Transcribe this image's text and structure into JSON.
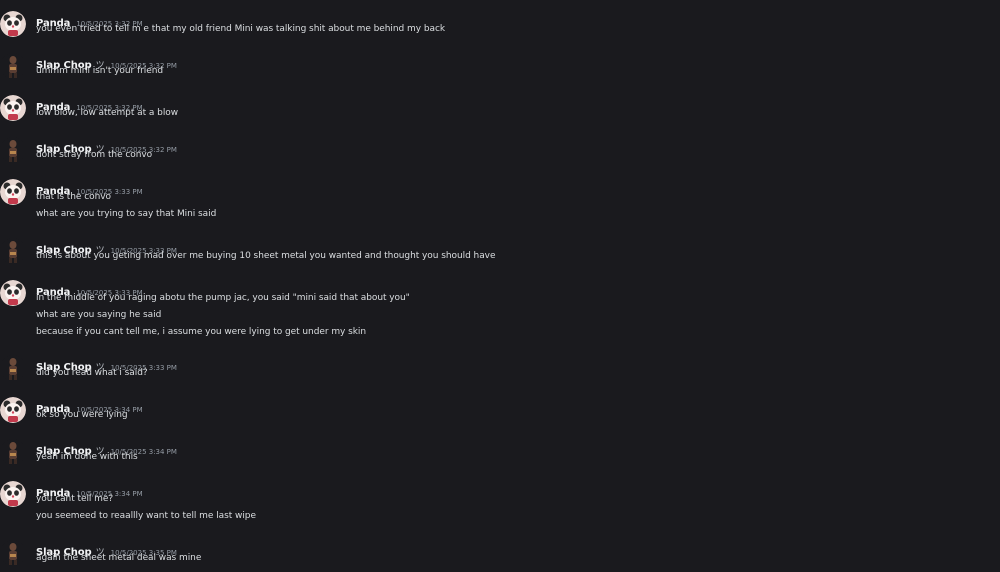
{
  "theme": {
    "background": "#1a1a1e",
    "username_color": "#f2f3f5",
    "text_color": "#dbdee1",
    "timestamp_color": "#949ba4"
  },
  "users": {
    "panda": {
      "name": "Panda",
      "avatar_icon": "panda-avatar-icon"
    },
    "slapchop": {
      "name": "Slap Chop",
      "badge": "ツ",
      "avatar_icon": "character-avatar-icon"
    }
  },
  "messages": [
    {
      "user": "Panda",
      "badge": "",
      "time": "10/5/2025 3:32 PM",
      "lines": [
        "you even tried to tell m e that my old friend Mini was talking shit about me behind my back"
      ]
    },
    {
      "user": "Slap Chop",
      "badge": "ツ",
      "time": "10/5/2025 3:32 PM",
      "lines": [
        "ummm mini isn't your friend"
      ]
    },
    {
      "user": "Panda",
      "badge": "",
      "time": "10/5/2025 3:32 PM",
      "lines": [
        "low blow, low attempt at a blow"
      ]
    },
    {
      "user": "Slap Chop",
      "badge": "ツ",
      "time": "10/5/2025 3:32 PM",
      "lines": [
        "dont stray from the convo"
      ]
    },
    {
      "user": "Panda",
      "badge": "",
      "time": "10/5/2025 3:33 PM",
      "lines": [
        "that is the convo",
        "what are you trying to say that Mini said"
      ]
    },
    {
      "user": "Slap Chop",
      "badge": "ツ",
      "time": "10/5/2025 3:33 PM",
      "lines": [
        "this is about you geting mad over me buying 10 sheet metal you wanted and thought you should have"
      ]
    },
    {
      "user": "Panda",
      "badge": "",
      "time": "10/5/2025 3:33 PM",
      "lines": [
        "in the middle of you raging abotu the pump jac, you said \"mini said that about you\"",
        "what are you saying he said",
        "because if you cant tell  me, i assume you were lying to get under my skin"
      ]
    },
    {
      "user": "Slap Chop",
      "badge": "ツ",
      "time": "10/5/2025 3:33 PM",
      "lines": [
        "did you read what i said?"
      ]
    },
    {
      "user": "Panda",
      "badge": "",
      "time": "10/5/2025 3:34 PM",
      "lines": [
        "ok so you were lying"
      ]
    },
    {
      "user": "Slap Chop",
      "badge": "ツ",
      "time": "10/5/2025 3:34 PM",
      "lines": [
        "yeah im done with this"
      ]
    },
    {
      "user": "Panda",
      "badge": "",
      "time": "10/5/2025 3:34 PM",
      "lines": [
        "you cant tell me?",
        "you seemeed to reaallly want to tell me last wipe"
      ]
    },
    {
      "user": "Slap Chop",
      "badge": "ツ",
      "time": "10/5/2025 3:35 PM",
      "lines": [
        "again the sheet metal deal was mine"
      ]
    }
  ]
}
